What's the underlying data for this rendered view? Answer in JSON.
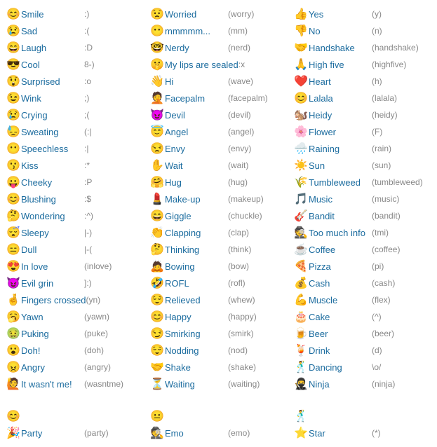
{
  "columns": [
    {
      "id": "col1",
      "items": [
        {
          "icon": "😊",
          "name": "Smile",
          "code": ":)"
        },
        {
          "icon": "😢",
          "name": "Sad",
          "code": ":("
        },
        {
          "icon": "😄",
          "name": "Laugh",
          "code": ":D"
        },
        {
          "icon": "😎",
          "name": "Cool",
          "code": "8-)"
        },
        {
          "icon": "😲",
          "name": "Surprised",
          "code": ":o"
        },
        {
          "icon": "😉",
          "name": "Wink",
          "code": ";)"
        },
        {
          "icon": "😢",
          "name": "Crying",
          "code": ";("
        },
        {
          "icon": "😓",
          "name": "Sweating",
          "code": "(:|"
        },
        {
          "icon": "😶",
          "name": "Speechless",
          "code": ":|"
        },
        {
          "icon": "😗",
          "name": "Kiss",
          "code": ":*"
        },
        {
          "icon": "😛",
          "name": "Cheeky",
          "code": ":P"
        },
        {
          "icon": "😊",
          "name": "Blushing",
          "code": ":$"
        },
        {
          "icon": "🤔",
          "name": "Wondering",
          "code": ":^)"
        },
        {
          "icon": "😴",
          "name": "Sleepy",
          "code": "|-)"
        },
        {
          "icon": "😑",
          "name": "Dull",
          "code": "|-("
        },
        {
          "icon": "😍",
          "name": "In love",
          "code": "(inlove)"
        },
        {
          "icon": "😈",
          "name": "Evil grin",
          "code": "]:)"
        },
        {
          "icon": "🤞",
          "name": "Fingers crossed",
          "code": "(yn)"
        },
        {
          "icon": "🥱",
          "name": "Yawn",
          "code": "(yawn)"
        },
        {
          "icon": "🤢",
          "name": "Puking",
          "code": "(puke)"
        },
        {
          "icon": "😮",
          "name": "Doh!",
          "code": "(doh)"
        },
        {
          "icon": "😠",
          "name": "Angry",
          "code": "(angry)"
        },
        {
          "icon": "🙋",
          "name": "It wasn't me!",
          "code": "(wasntme)"
        },
        {
          "icon": "",
          "name": "",
          "code": ""
        },
        {
          "icon": "😊",
          "name": "",
          "code": ""
        },
        {
          "icon": "🎉",
          "name": "Party",
          "code": "(party)"
        }
      ]
    },
    {
      "id": "col2",
      "items": [
        {
          "icon": "😟",
          "name": "Worried",
          "code": "(worry)"
        },
        {
          "icon": "😶",
          "name": "mmmmm...",
          "code": "(mm)"
        },
        {
          "icon": "🤓",
          "name": "Nerdy",
          "code": "(nerd)"
        },
        {
          "icon": "🤫",
          "name": "My lips are sealed",
          "code": ":x"
        },
        {
          "icon": "👋",
          "name": "Hi",
          "code": "(wave)"
        },
        {
          "icon": "🤦",
          "name": "Facepalm",
          "code": "(facepalm)"
        },
        {
          "icon": "😈",
          "name": "Devil",
          "code": "(devil)"
        },
        {
          "icon": "😇",
          "name": "Angel",
          "code": "(angel)"
        },
        {
          "icon": "😒",
          "name": "Envy",
          "code": "(envy)"
        },
        {
          "icon": "✋",
          "name": "Wait",
          "code": "(wait)"
        },
        {
          "icon": "🤗",
          "name": "Hug",
          "code": "(hug)"
        },
        {
          "icon": "💄",
          "name": "Make-up",
          "code": "(makeup)"
        },
        {
          "icon": "😄",
          "name": "Giggle",
          "code": "(chuckle)"
        },
        {
          "icon": "👏",
          "name": "Clapping",
          "code": "(clap)"
        },
        {
          "icon": "🤔",
          "name": "Thinking",
          "code": "(think)"
        },
        {
          "icon": "🙇",
          "name": "Bowing",
          "code": "(bow)"
        },
        {
          "icon": "🤣",
          "name": "ROFL",
          "code": "(rofl)"
        },
        {
          "icon": "😌",
          "name": "Relieved",
          "code": "(whew)"
        },
        {
          "icon": "😊",
          "name": "Happy",
          "code": "(happy)"
        },
        {
          "icon": "😏",
          "name": "Smirking",
          "code": "(smirk)"
        },
        {
          "icon": "😌",
          "name": "Nodding",
          "code": "(nod)"
        },
        {
          "icon": "🤝",
          "name": "Shake",
          "code": "(shake)"
        },
        {
          "icon": "⏳",
          "name": "Waiting",
          "code": "(waiting)"
        },
        {
          "icon": "",
          "name": "",
          "code": ""
        },
        {
          "icon": "😐",
          "name": "",
          "code": ""
        },
        {
          "icon": "🕵️",
          "name": "Emo",
          "code": "(emo)"
        }
      ]
    },
    {
      "id": "col3",
      "items": [
        {
          "icon": "👍",
          "name": "Yes",
          "code": "(y)"
        },
        {
          "icon": "👎",
          "name": "No",
          "code": "(n)"
        },
        {
          "icon": "🤝",
          "name": "Handshake",
          "code": "(handshake)"
        },
        {
          "icon": "🙏",
          "name": "High five",
          "code": "(highfive)"
        },
        {
          "icon": "❤️",
          "name": "Heart",
          "code": "(h)"
        },
        {
          "icon": "😊",
          "name": "Lalala",
          "code": "(lalala)"
        },
        {
          "icon": "🐿️",
          "name": "Heidy",
          "code": "(heidy)"
        },
        {
          "icon": "🌸",
          "name": "Flower",
          "code": "(F)"
        },
        {
          "icon": "🌧️",
          "name": "Raining",
          "code": "(rain)"
        },
        {
          "icon": "☀️",
          "name": "Sun",
          "code": "(sun)"
        },
        {
          "icon": "🌾",
          "name": "Tumbleweed",
          "code": "(tumbleweed)"
        },
        {
          "icon": "🎵",
          "name": "Music",
          "code": "(music)"
        },
        {
          "icon": "🎸",
          "name": "Bandit",
          "code": "(bandit)"
        },
        {
          "icon": "🕵️",
          "name": "Too much info",
          "code": "(tmi)"
        },
        {
          "icon": "☕",
          "name": "Coffee",
          "code": "(coffee)"
        },
        {
          "icon": "🍕",
          "name": "Pizza",
          "code": "(pi)"
        },
        {
          "icon": "💰",
          "name": "Cash",
          "code": "(cash)"
        },
        {
          "icon": "💪",
          "name": "Muscle",
          "code": "(flex)"
        },
        {
          "icon": "🎂",
          "name": "Cake",
          "code": "(^)"
        },
        {
          "icon": "🍺",
          "name": "Beer",
          "code": "(beer)"
        },
        {
          "icon": "🍹",
          "name": "Drink",
          "code": "(d)"
        },
        {
          "icon": "🕺",
          "name": "Dancing",
          "code": "\\o/"
        },
        {
          "icon": "🥷",
          "name": "Ninja",
          "code": "(ninja)"
        },
        {
          "icon": "",
          "name": "",
          "code": ""
        },
        {
          "icon": "🕺",
          "name": "",
          "code": ""
        },
        {
          "icon": "⭐",
          "name": "Star",
          "code": "(*)"
        }
      ]
    }
  ]
}
